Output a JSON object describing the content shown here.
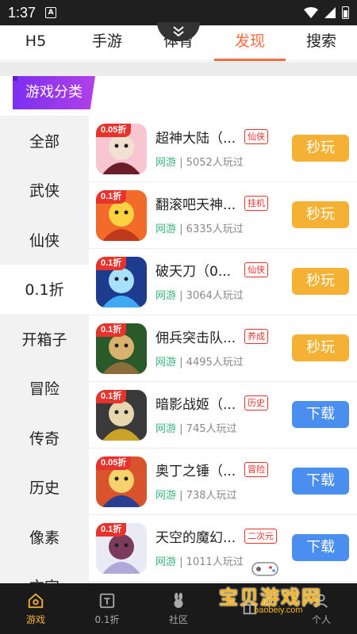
{
  "status": {
    "time": "1:37",
    "app_glyph": "A"
  },
  "top_tabs": [
    {
      "label": "H5"
    },
    {
      "label": "手游"
    },
    {
      "label": "体育"
    },
    {
      "label": "发现"
    },
    {
      "label": "搜索"
    }
  ],
  "active_top_tab": "发现",
  "category_header": "游戏分类",
  "sidebar": [
    {
      "label": "全部"
    },
    {
      "label": "武侠"
    },
    {
      "label": "仙侠"
    },
    {
      "label": "0.1折"
    },
    {
      "label": "开箱子"
    },
    {
      "label": "冒险"
    },
    {
      "label": "传奇"
    },
    {
      "label": "历史"
    },
    {
      "label": "像素"
    },
    {
      "label": "文字"
    }
  ],
  "active_sidebar": "0.1折",
  "games": [
    {
      "name": "超神大陆（...",
      "tag": "仙侠",
      "discount": "0.05折",
      "category": "网游",
      "players": "5052人玩过",
      "button": "秒玩",
      "button_type": "play"
    },
    {
      "name": "翻滚吧天神...",
      "tag": "挂机",
      "discount": "0.1折",
      "category": "网游",
      "players": "6335人玩过",
      "button": "秒玩",
      "button_type": "play"
    },
    {
      "name": "破天刀（0...",
      "tag": "仙侠",
      "discount": "0.1折",
      "category": "网游",
      "players": "3064人玩过",
      "button": "秒玩",
      "button_type": "play"
    },
    {
      "name": "佣兵突击队...",
      "tag": "养成",
      "discount": "0.1折",
      "category": "网游",
      "players": "4495人玩过",
      "button": "秒玩",
      "button_type": "play"
    },
    {
      "name": "暗影战姬（...",
      "tag": "历史",
      "discount": "0.1折",
      "category": "网游",
      "players": "745人玩过",
      "button": "下载",
      "button_type": "download"
    },
    {
      "name": "奥丁之锤（...",
      "tag": "冒险",
      "discount": "0.05折",
      "category": "网游",
      "players": "738人玩过",
      "button": "下载",
      "button_type": "download"
    },
    {
      "name": "天空的魔幻...",
      "tag": "二次元",
      "discount": "0.1折",
      "category": "网游",
      "players": "1011人玩过",
      "button": "下载",
      "button_type": "download"
    }
  ],
  "bottom_nav": [
    {
      "label": "游戏",
      "icon": "home-icon"
    },
    {
      "label": "0.1折",
      "icon": "discount-icon"
    },
    {
      "label": "社区",
      "icon": "rabbit-icon"
    },
    {
      "label": "",
      "icon": "gift-icon"
    },
    {
      "label": "个人",
      "icon": "user-icon"
    }
  ],
  "watermark": {
    "text": "宝贝游戏网",
    "url": "baobeiy.com"
  },
  "colors": {
    "accent": "#ff6a3d",
    "play": "#f5b133",
    "download": "#4a8ff0",
    "tag": "#e8322c",
    "category_badge": "#8a2be2",
    "green": "#3cb57d"
  }
}
